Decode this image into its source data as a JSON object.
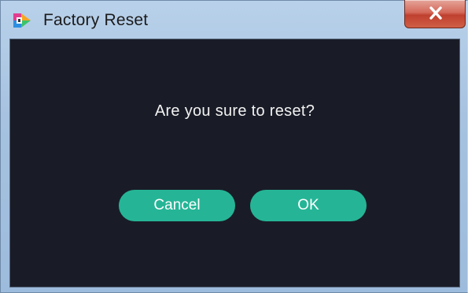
{
  "window": {
    "title": "Factory Reset",
    "icon": "app-logo-icon",
    "close_icon": "close-icon"
  },
  "dialog": {
    "message": "Are you sure to reset?",
    "cancel_label": "Cancel",
    "ok_label": "OK"
  },
  "colors": {
    "dialog_background": "#191c27",
    "button_accent": "#25b596",
    "close_button": "#c9503c"
  }
}
